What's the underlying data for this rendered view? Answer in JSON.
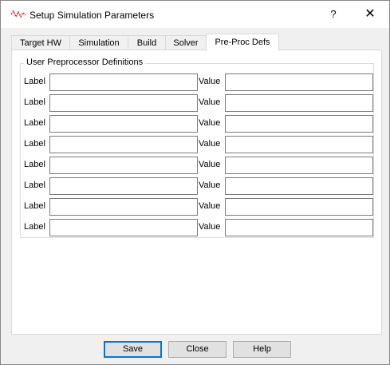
{
  "window": {
    "title": "Setup Simulation Parameters",
    "help_glyph": "?",
    "close_glyph": "✕"
  },
  "tabs": [
    {
      "label": "Target HW"
    },
    {
      "label": "Simulation"
    },
    {
      "label": "Build"
    },
    {
      "label": "Solver"
    },
    {
      "label": "Pre-Proc Defs",
      "active": true
    }
  ],
  "group": {
    "title": "User Preprocessor Definitions",
    "rows": [
      {
        "label_text": "Label",
        "label_value": "",
        "value_text": "Value",
        "value_value": ""
      },
      {
        "label_text": "Label",
        "label_value": "",
        "value_text": "Value",
        "value_value": ""
      },
      {
        "label_text": "Label",
        "label_value": "",
        "value_text": "Value",
        "value_value": ""
      },
      {
        "label_text": "Label",
        "label_value": "",
        "value_text": "Value",
        "value_value": ""
      },
      {
        "label_text": "Label",
        "label_value": "",
        "value_text": "Value",
        "value_value": ""
      },
      {
        "label_text": "Label",
        "label_value": "",
        "value_text": "Value",
        "value_value": ""
      },
      {
        "label_text": "Label",
        "label_value": "",
        "value_text": "Value",
        "value_value": ""
      },
      {
        "label_text": "Label",
        "label_value": "",
        "value_text": "Value",
        "value_value": ""
      }
    ]
  },
  "buttons": {
    "save": "Save",
    "close": "Close",
    "help": "Help"
  },
  "colors": {
    "accent": "#0078d7",
    "icon_red": "#e03030"
  }
}
